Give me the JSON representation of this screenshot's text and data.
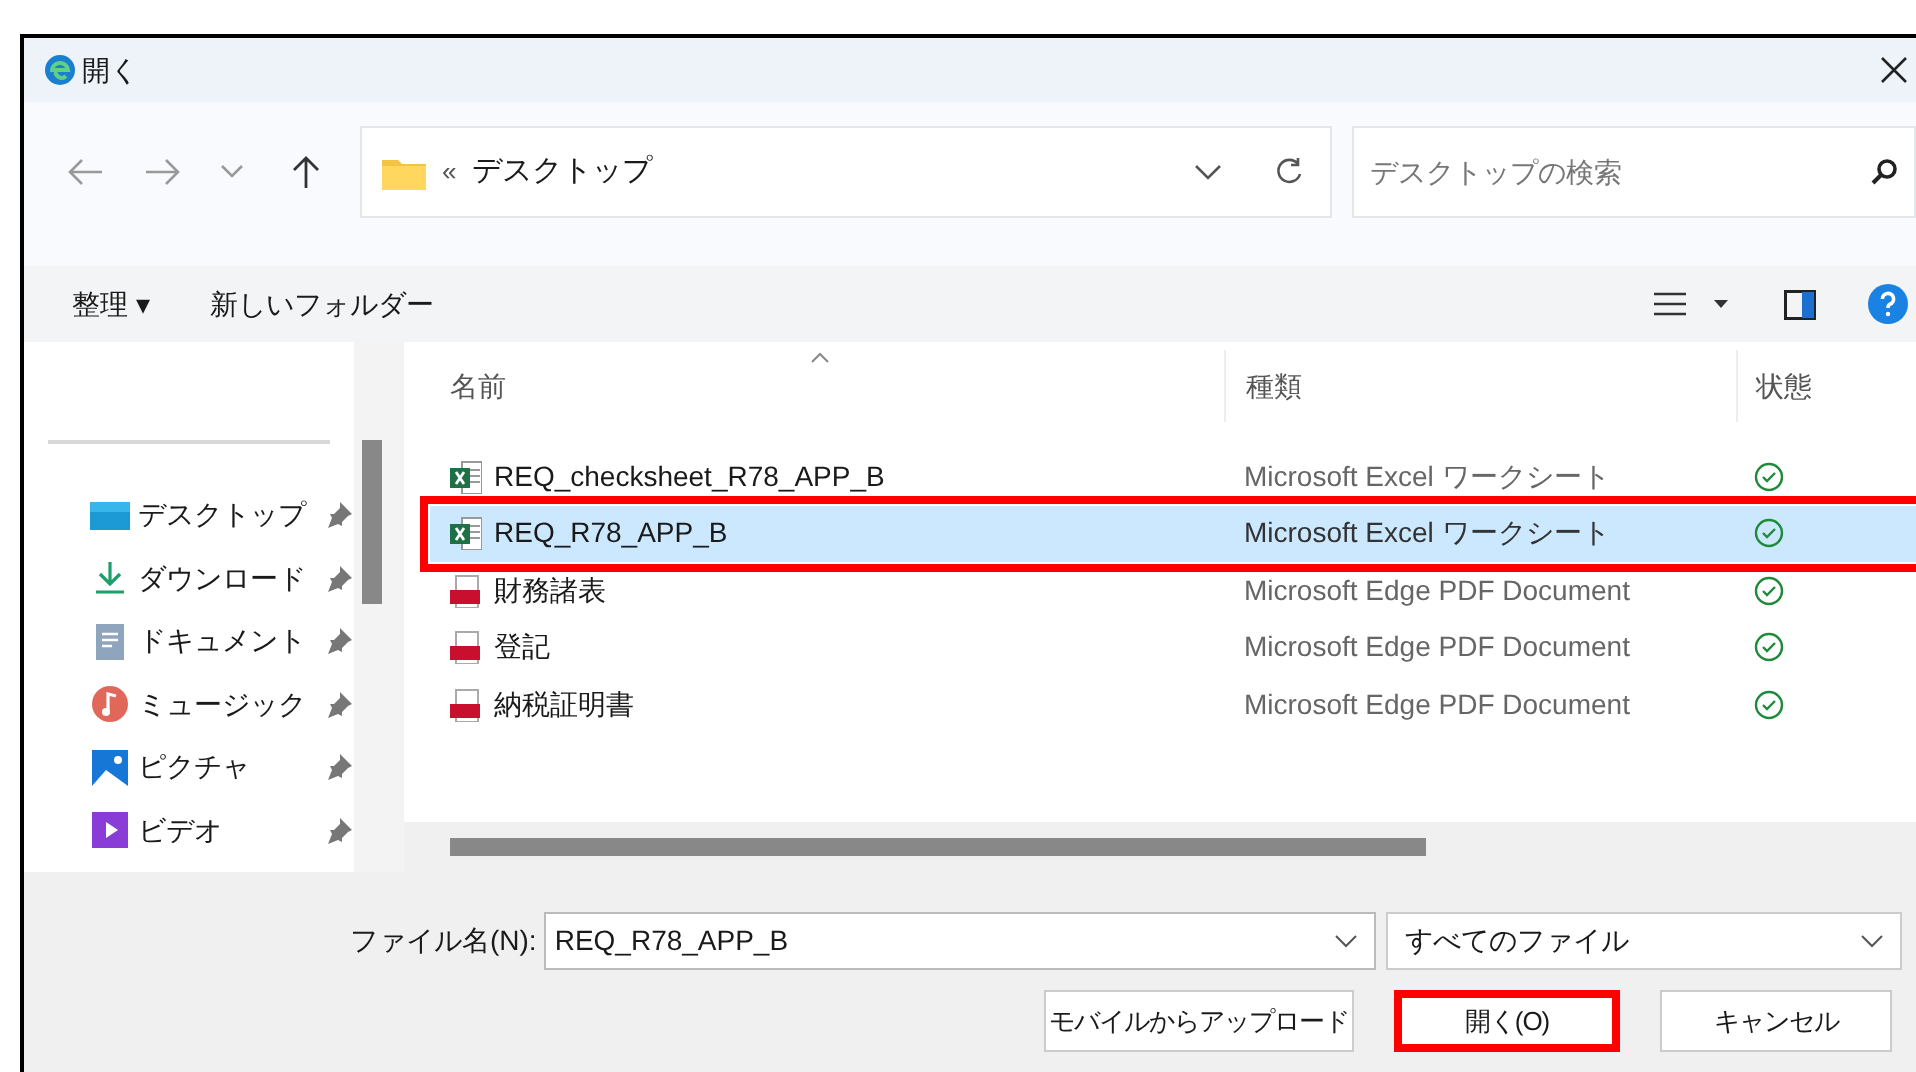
{
  "window": {
    "title": "開く"
  },
  "navigation": {
    "address_prefix": "«",
    "address": "デスクトップ",
    "search": {
      "placeholder": "デスクトップの検索"
    }
  },
  "toolbar": {
    "organize": "整理 ▾",
    "new_folder": "新しいフォルダー"
  },
  "sidebar": {
    "items": [
      {
        "label": "デスクトップ",
        "kind": "desktop",
        "pinned": true
      },
      {
        "label": "ダウンロード",
        "kind": "download",
        "pinned": true
      },
      {
        "label": "ドキュメント",
        "kind": "document",
        "pinned": true
      },
      {
        "label": "ミュージック",
        "kind": "music",
        "pinned": true
      },
      {
        "label": "ピクチャ",
        "kind": "picture",
        "pinned": true
      },
      {
        "label": "ビデオ",
        "kind": "video",
        "pinned": true
      }
    ]
  },
  "file_list": {
    "columns": [
      "名前",
      "種類",
      "状態"
    ],
    "rows": [
      {
        "name": "REQ_checksheet_R78_APP_B",
        "kind": "excel",
        "type": "Microsoft Excel ワークシート",
        "selected": false,
        "annotated": false
      },
      {
        "name": "REQ_R78_APP_B",
        "kind": "excel",
        "type": "Microsoft Excel ワークシート",
        "selected": true,
        "annotated": true
      },
      {
        "name": "財務諸表",
        "kind": "pdf",
        "type": "Microsoft Edge PDF Document",
        "selected": false,
        "annotated": false
      },
      {
        "name": "登記",
        "kind": "pdf",
        "type": "Microsoft Edge PDF Document",
        "selected": false,
        "annotated": false
      },
      {
        "name": "納税証明書",
        "kind": "pdf",
        "type": "Microsoft Edge PDF Document",
        "selected": false,
        "annotated": false
      }
    ]
  },
  "footer": {
    "filename_label": "ファイル名(N):",
    "filename": "REQ_R78_APP_B",
    "filter": "すべてのファイル",
    "buttons": [
      {
        "label": "モバイルからアップロード",
        "annotated": false
      },
      {
        "label": "開く(O)",
        "annotated": true
      },
      {
        "label": "キャンセル",
        "annotated": false
      }
    ]
  }
}
